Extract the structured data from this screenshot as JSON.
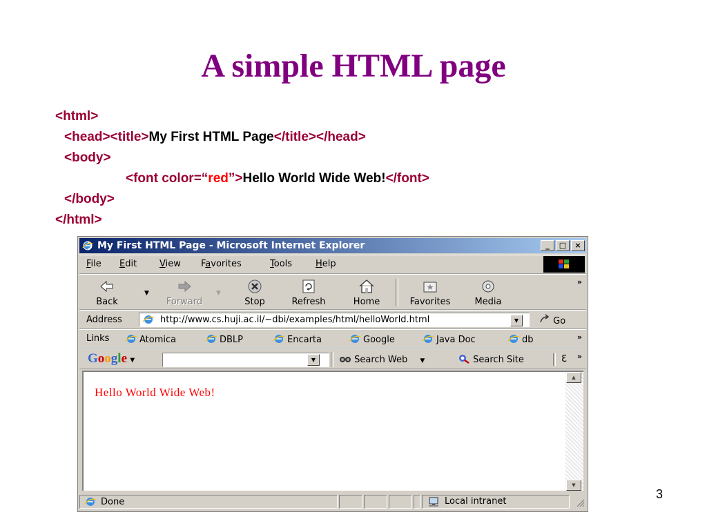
{
  "slide": {
    "title": "A simple HTML page",
    "page_number": "3",
    "code": {
      "line1": {
        "tag": "<html>"
      },
      "line2": {
        "tag1": "<head><title>",
        "text": "My First HTML Page",
        "tag2": "</title></head>"
      },
      "line3": {
        "tag": "<body>"
      },
      "line4": {
        "tag1": "<font color=“",
        "value": "red",
        "tag2": "”>",
        "text": "Hello World Wide Web!",
        "tag3": "</font>"
      },
      "line5": {
        "tag": "</body>"
      },
      "line6": {
        "tag": "</html>"
      }
    }
  },
  "browser": {
    "window_title": "My First HTML Page - Microsoft Internet Explorer",
    "window_controls": {
      "minimize": "_",
      "maximize": "□",
      "close": "×"
    },
    "menu": [
      "File",
      "Edit",
      "View",
      "Favorites",
      "Tools",
      "Help"
    ],
    "menu_accel": [
      "F",
      "E",
      "V",
      "a",
      "T",
      "H"
    ],
    "toolbar": {
      "back": "Back",
      "forward": "Forward",
      "stop": "Stop",
      "refresh": "Refresh",
      "home": "Home",
      "favorites": "Favorites",
      "media": "Media",
      "more": "»"
    },
    "address": {
      "label": "Address",
      "url": "http://www.cs.huji.ac.il/~dbi/examples/html/helloWorld.html",
      "go": "Go"
    },
    "links": {
      "label": "Links",
      "items": [
        "Atomica",
        "DBLP",
        "Encarta",
        "Google",
        "Java Doc",
        "db"
      ],
      "more": "»"
    },
    "google_toolbar": {
      "logo": [
        "G",
        "o",
        "o",
        "g",
        "l",
        "e"
      ],
      "logo_colors": [
        "#3366cc",
        "#cc0000",
        "#ff9900",
        "#3366cc",
        "#339933",
        "#cc0000"
      ],
      "dropdown": "▾",
      "search_value": "",
      "search_web": "Search Web",
      "search_site": "Search Site",
      "trailing": "Ɛ",
      "more": "»"
    },
    "page": {
      "content_text": "Hello World Wide Web!",
      "content_color": "#ff0000"
    },
    "status": {
      "text": "Done",
      "zone": "Local intranet"
    },
    "colors": {
      "titlebar_start": "#0a246a",
      "titlebar_end": "#a6caf0",
      "chrome": "#d4d0c8",
      "slide_title": "#800080",
      "code_tag": "#990033"
    }
  }
}
